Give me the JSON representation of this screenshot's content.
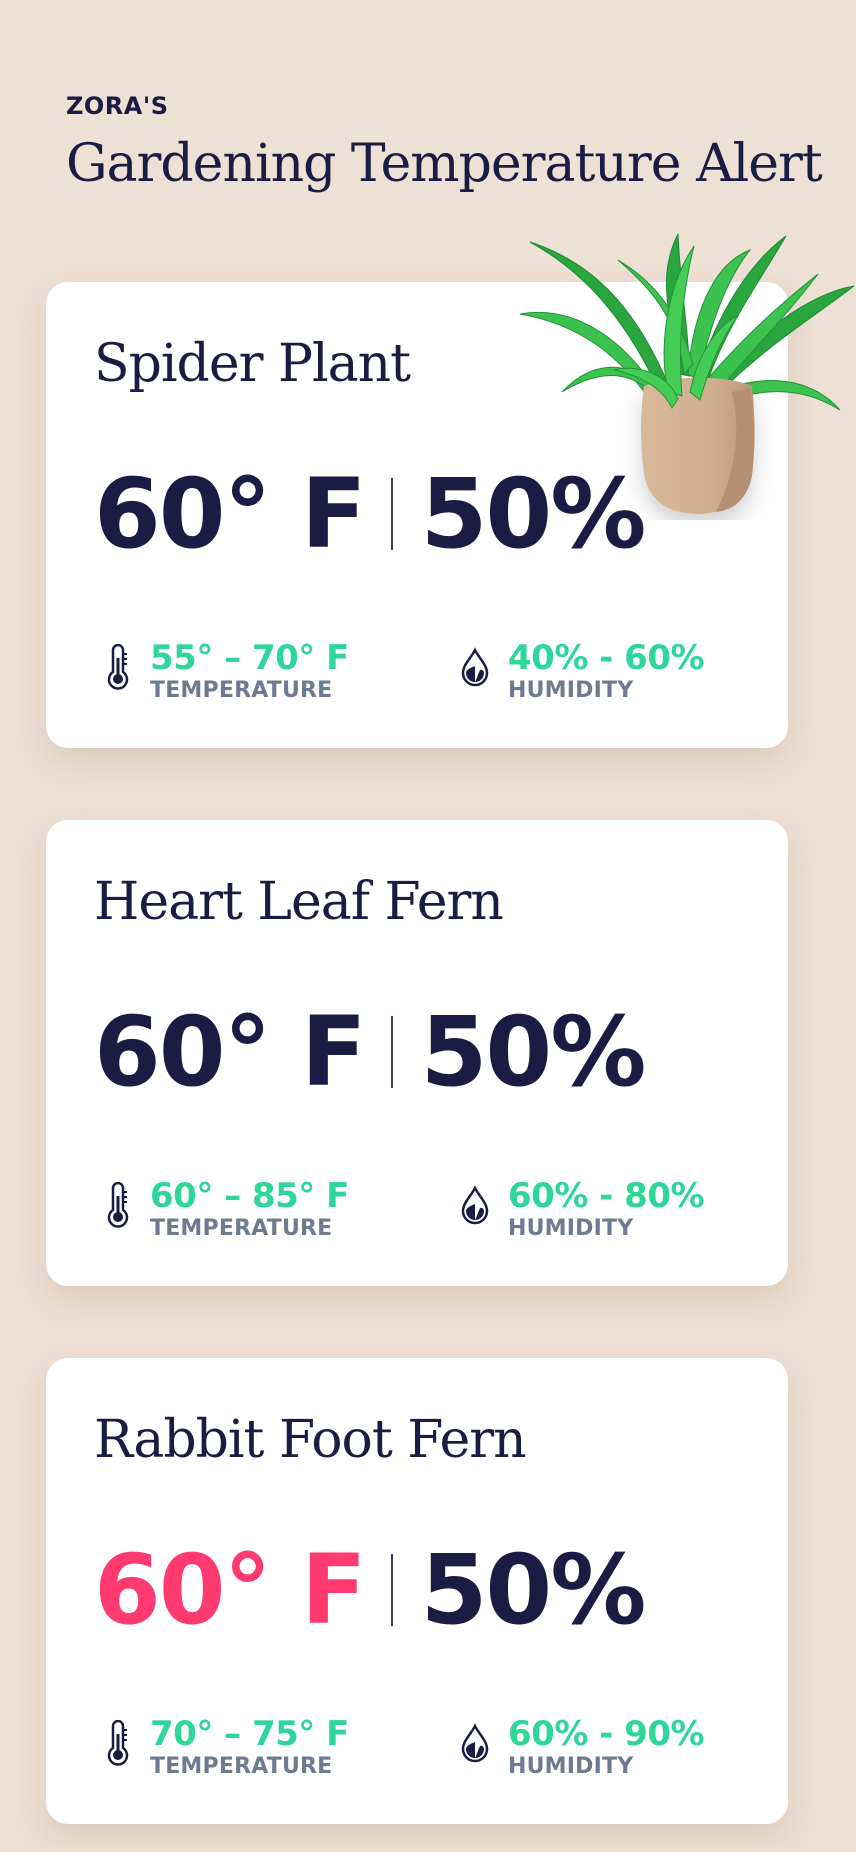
{
  "header": {
    "brand": "ZORA'S",
    "title": "Gardening Temperature Alert"
  },
  "plants": [
    {
      "name": "Spider Plant",
      "temperature": "60° F",
      "humidity": "50%",
      "temperature_range": "55° – 70° F",
      "temperature_label": "TEMPERATURE",
      "humidity_range": "40% - 60%",
      "humidity_label": "HUMIDITY",
      "temperature_alert": false
    },
    {
      "name": "Heart Leaf Fern",
      "temperature": "60° F",
      "humidity": "50%",
      "temperature_range": "60° – 85° F",
      "temperature_label": "TEMPERATURE",
      "humidity_range": "60% - 80%",
      "humidity_label": "HUMIDITY",
      "temperature_alert": false
    },
    {
      "name": "Rabbit Foot Fern",
      "temperature": "60° F",
      "humidity": "50%",
      "temperature_range": "70° – 75° F",
      "temperature_label": "TEMPERATURE",
      "humidity_range": "60% - 90%",
      "humidity_label": "HUMIDITY",
      "temperature_alert": true
    }
  ],
  "icons": {
    "temperature": "thermometer-icon",
    "humidity": "water-drop-icon",
    "illustration": "potted-spider-plant"
  },
  "colors": {
    "background": "#ede0d4",
    "text": "#1b1c44",
    "range_green": "#2ed69a",
    "alert_red": "#ff3a6f",
    "label_gray": "#6d7a8f"
  }
}
